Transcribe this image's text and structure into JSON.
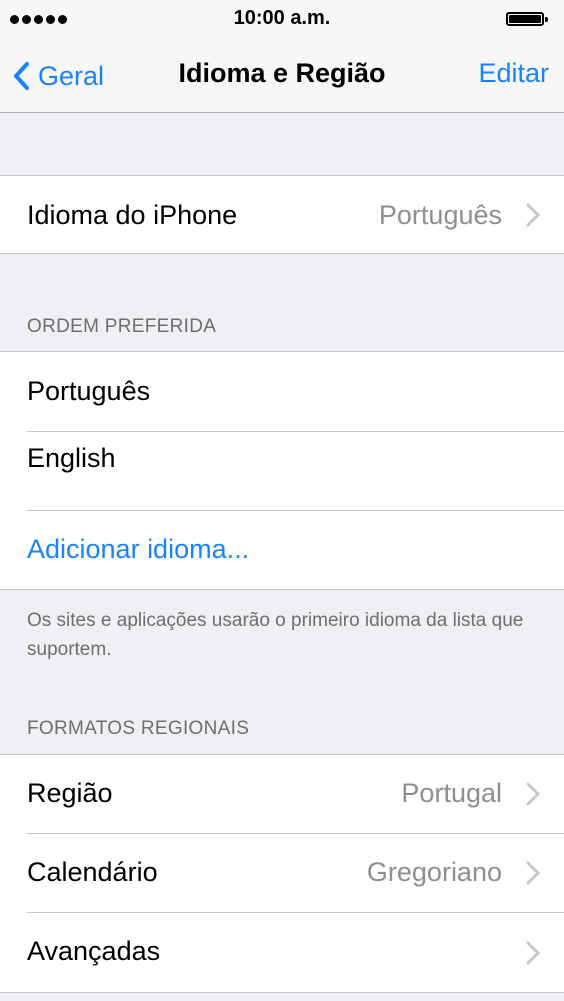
{
  "status_bar": {
    "time": "10:00 a.m."
  },
  "nav": {
    "back_label": "Geral",
    "title": "Idioma e Região",
    "edit_label": "Editar"
  },
  "iphone_language": {
    "label": "Idioma do iPhone",
    "value": "Português"
  },
  "preferred_order": {
    "header": "ORDEM PREFERIDA",
    "languages": [
      "Português",
      "English"
    ],
    "add_label": "Adicionar idioma...",
    "footer": "Os sites e aplicações usarão o primeiro idioma da lista que suportem."
  },
  "regional_formats": {
    "header": "FORMATOS REGIONAIS",
    "rows": [
      {
        "label": "Região",
        "value": "Portugal"
      },
      {
        "label": "Calendário",
        "value": "Gregoriano"
      },
      {
        "label": "Avançadas",
        "value": ""
      }
    ]
  },
  "colors": {
    "accent": "#1a82fb",
    "background": "#efeff4",
    "secondary_text": "#8e8e93"
  }
}
